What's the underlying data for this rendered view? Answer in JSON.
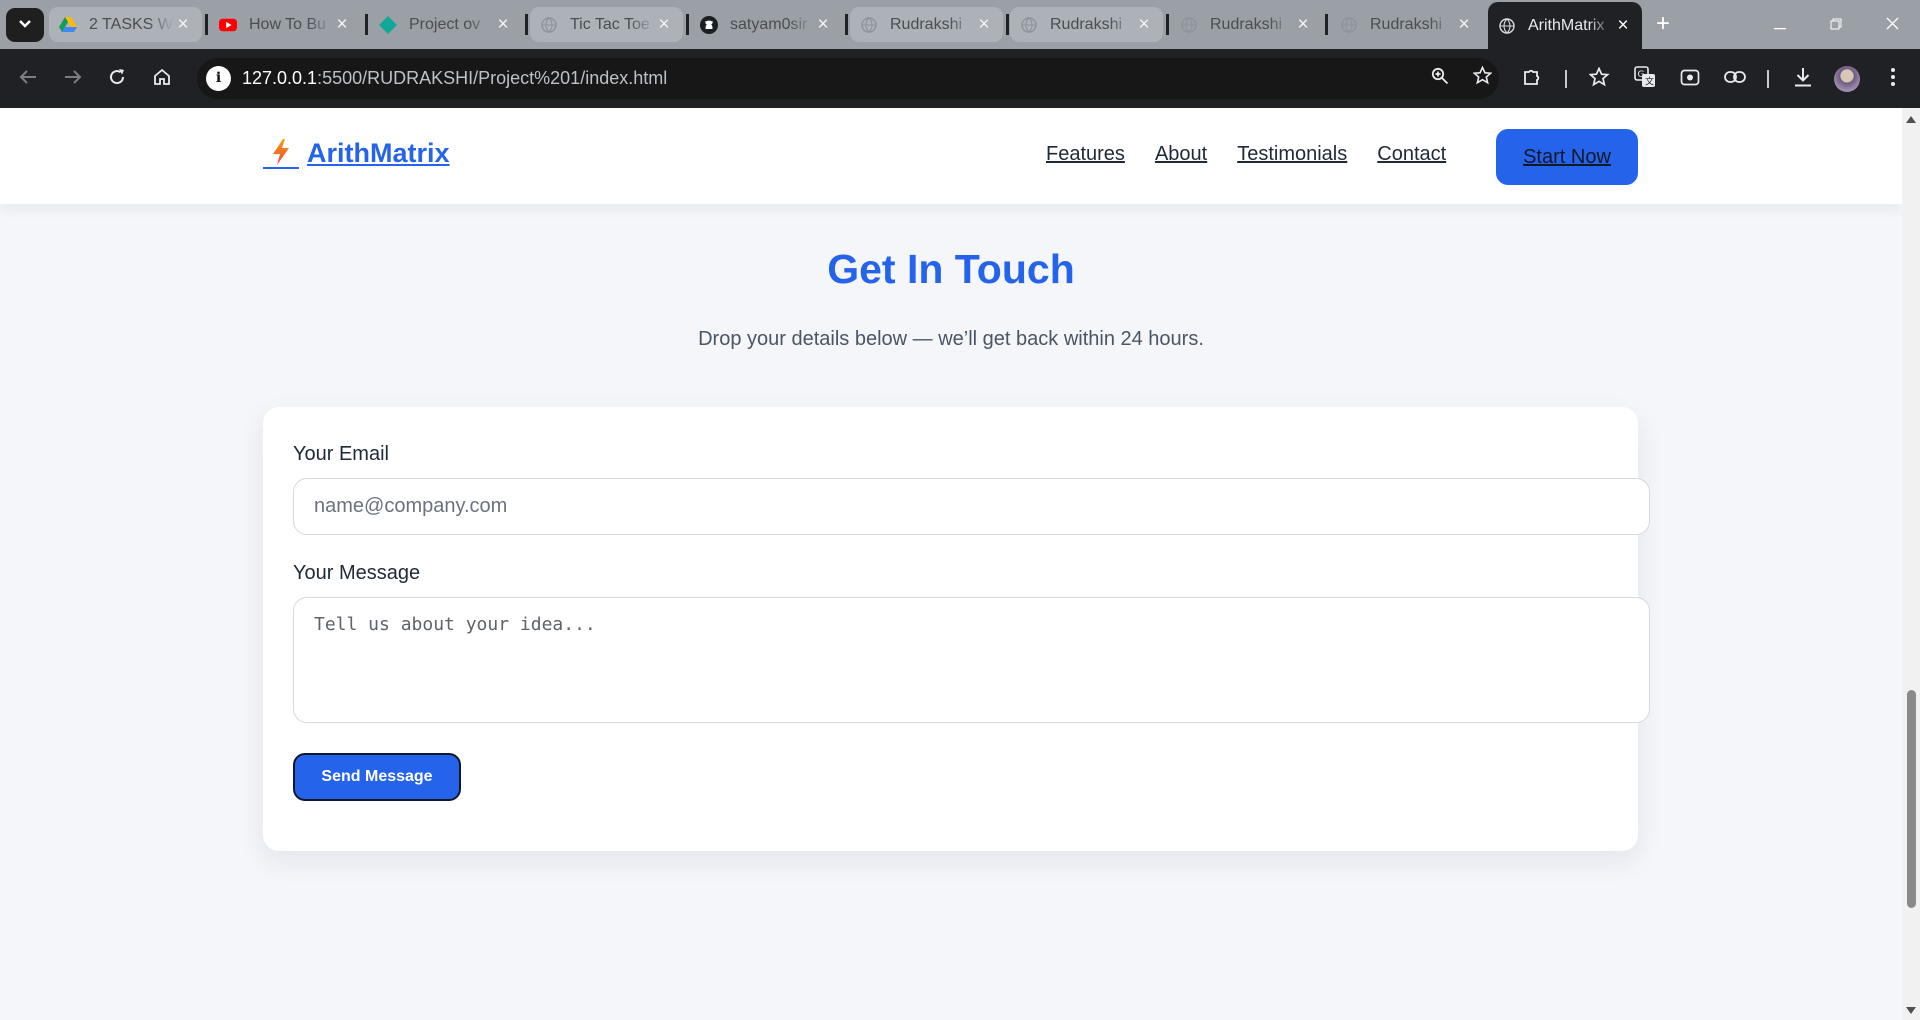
{
  "browser": {
    "tabs": [
      {
        "title": "2 TASKS W",
        "icon": "google-drive-icon"
      },
      {
        "title": "How To Bu",
        "icon": "youtube-icon"
      },
      {
        "title": "Project ov",
        "icon": "diamond-icon"
      },
      {
        "title": "Tic Tac Toe",
        "icon": "globe-icon"
      },
      {
        "title": "satyam0sir",
        "icon": "github-icon"
      },
      {
        "title": "Rudrakshi",
        "icon": "globe-icon"
      },
      {
        "title": "Rudrakshi",
        "icon": "globe-icon"
      },
      {
        "title": "Rudrakshi",
        "icon": "globe-icon"
      },
      {
        "title": "Rudrakshi",
        "icon": "globe-icon"
      },
      {
        "title": "ArithMatrix",
        "icon": "globe-icon",
        "active": true
      }
    ],
    "url_host": "127.0.0.1",
    "url_path": ":5500/RUDRAKSHI/Project%201/index.html"
  },
  "site": {
    "brand_icon": "⚡",
    "brand": "ArithMatrix",
    "nav": [
      "Features",
      "About",
      "Testimonials",
      "Contact"
    ],
    "cta": "Start Now",
    "accent": "#2563eb"
  },
  "contact": {
    "title": "Get In Touch",
    "subtitle": "Drop your details below — we’ll get back within 24 hours.",
    "email_label": "Your Email",
    "email_placeholder": "name@company.com",
    "message_label": "Your Message",
    "message_placeholder": "Tell us about your idea...",
    "send_label": "Send Message"
  }
}
